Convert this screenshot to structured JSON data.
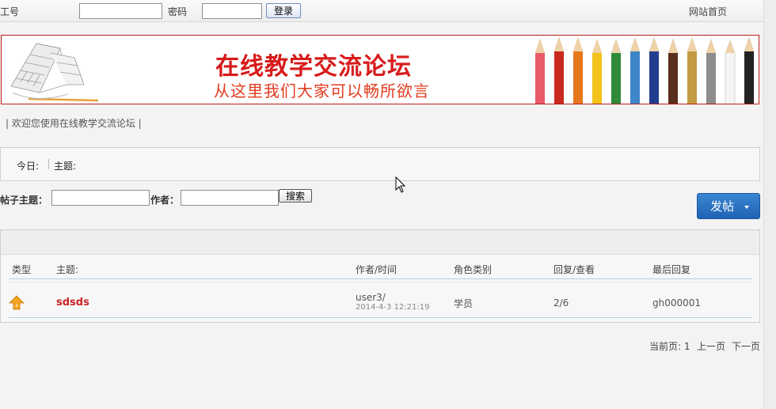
{
  "topbar": {
    "id_label": "工号",
    "id_value": "",
    "password_label": "密码",
    "password_value": "",
    "login_label": "登录",
    "home_link": "网站首页"
  },
  "banner": {
    "title": "在线教学交流论坛",
    "subtitle": "从这里我们大家可以畅所欲言"
  },
  "welcome": "| 欢迎您使用在线教学交流论坛 |",
  "stats": {
    "today_label": "今日:",
    "topics_label": "主题:"
  },
  "search": {
    "topic_label": "帖子主题：",
    "topic_value": "",
    "author_label": "作者：",
    "author_value": "",
    "button_label": "搜索"
  },
  "post_button": "发帖",
  "table": {
    "headers": [
      "类型",
      "主题:",
      "作者/时间",
      "角色类别",
      "回复/查看",
      "最后回复"
    ],
    "rows": [
      {
        "title": "sdsds",
        "author": "user3/",
        "time": "2014-4-3 12:21:19",
        "role": "学员",
        "reply_view": "2/6",
        "last_reply": "gh000001"
      }
    ]
  },
  "pager": {
    "current": "当前页: 1",
    "prev": "上一页",
    "next": "下一页"
  },
  "colors": {
    "accent_blue": "#1f63b4",
    "title_red": "#d71b1b",
    "banner_border": "#b81c1c"
  }
}
